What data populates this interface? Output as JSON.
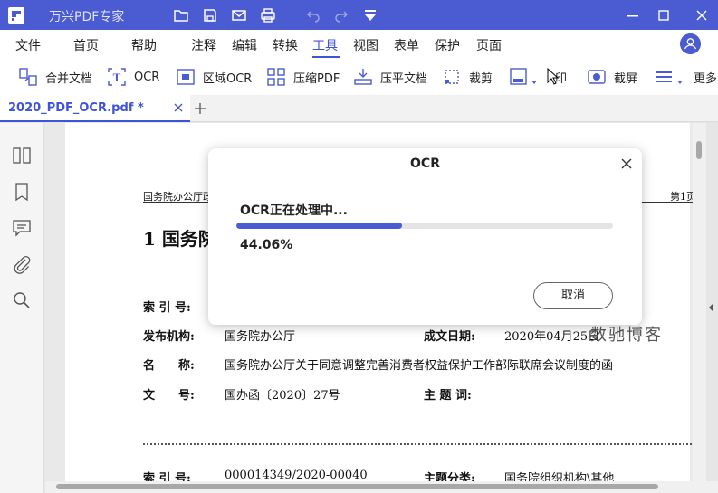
{
  "app": {
    "title": "万兴PDF专家",
    "brand_color": "#4b5bd1"
  },
  "quick_toolbar": {
    "icons": [
      "folder-icon",
      "save-icon",
      "mail-icon",
      "print-icon",
      "undo-icon",
      "redo-icon",
      "customize-dropdown-icon"
    ]
  },
  "menubar": {
    "items": [
      "文件",
      "首页",
      "帮助",
      "注释",
      "编辑",
      "转换",
      "工具",
      "视图",
      "表单",
      "保护",
      "页面"
    ],
    "active": "工具"
  },
  "toolbar": {
    "items": [
      {
        "label": "合并文档",
        "icon": "merge-icon"
      },
      {
        "label": "OCR",
        "icon": "ocr-icon"
      },
      {
        "label": "区域OCR",
        "icon": "area-ocr-icon"
      },
      {
        "label": "压缩PDF",
        "icon": "compress-icon"
      },
      {
        "label": "压平文档",
        "icon": "flatten-icon"
      },
      {
        "label": "裁剪",
        "icon": "crop-icon"
      },
      {
        "label": "",
        "icon": "page-dropdown-icon"
      },
      {
        "label": "印",
        "icon": "stamp-icon"
      },
      {
        "label": "截屏",
        "icon": "screenshot-icon"
      },
      {
        "label": "",
        "icon": "list-dropdown-icon"
      },
      {
        "label": "更多",
        "icon": "more-icon"
      }
    ]
  },
  "tabs": [
    {
      "title": "2020_PDF_OCR.pdf *"
    }
  ],
  "document": {
    "header_left": "国务院办公厅政",
    "header_right": "第1页",
    "heading": "1 国务院",
    "rows": [
      {
        "label": "索 引 号:",
        "value": ""
      },
      {
        "label": "发布机构:",
        "value": "国务院办公厅",
        "label2": "成文日期:",
        "value2": "2020年04月25日"
      },
      {
        "label": "名　　称:",
        "value": "国务院办公厅关于同意调整完善消费者权益保护工作部际联席会议制度的函"
      },
      {
        "label": "文　　号:",
        "value": "国办函〔2020〕27号",
        "label2": "主 题 词:",
        "value2": ""
      }
    ],
    "next_row": {
      "label": "索 引 号:",
      "value": "000014349/2020-00040",
      "label2": "主题分类:",
      "value2": "国务院组织机构\\其他"
    },
    "watermark": "数驰博客"
  },
  "dialog": {
    "title": "OCR",
    "status": "OCR正在处理中...",
    "progress": 0.4406,
    "percent_text": "44.06%",
    "cancel_label": "取消"
  }
}
